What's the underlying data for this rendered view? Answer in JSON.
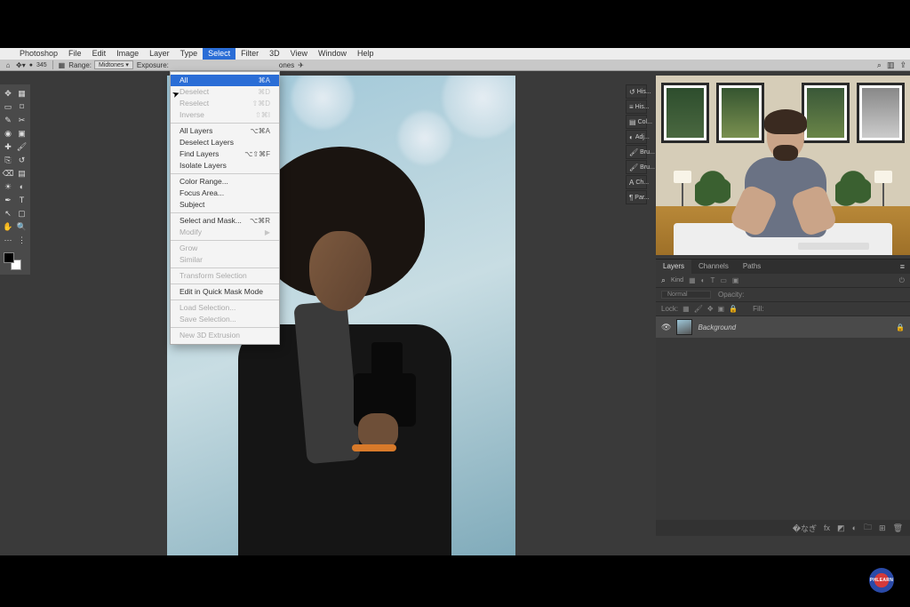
{
  "app_name": "Photoshop",
  "menubar": [
    "Photoshop",
    "File",
    "Edit",
    "Image",
    "Layer",
    "Type",
    "Select",
    "Filter",
    "3D",
    "View",
    "Window",
    "Help"
  ],
  "menubar_selected": "Select",
  "optionsbar": {
    "brush_size": "345",
    "range_label": "Range:",
    "range_value": "Midtones",
    "exposure_label": "Exposure:",
    "extra_label": "ones"
  },
  "dropdown": {
    "groups": [
      [
        {
          "label": "All",
          "shortcut": "⌘A",
          "enabled": true,
          "selected": true
        },
        {
          "label": "Deselect",
          "shortcut": "⌘D",
          "enabled": false
        },
        {
          "label": "Reselect",
          "shortcut": "⇧⌘D",
          "enabled": false
        },
        {
          "label": "Inverse",
          "shortcut": "⇧⌘I",
          "enabled": false
        }
      ],
      [
        {
          "label": "All Layers",
          "shortcut": "⌥⌘A",
          "enabled": true
        },
        {
          "label": "Deselect Layers",
          "shortcut": "",
          "enabled": true
        },
        {
          "label": "Find Layers",
          "shortcut": "⌥⇧⌘F",
          "enabled": true
        },
        {
          "label": "Isolate Layers",
          "shortcut": "",
          "enabled": true
        }
      ],
      [
        {
          "label": "Color Range...",
          "shortcut": "",
          "enabled": true
        },
        {
          "label": "Focus Area...",
          "shortcut": "",
          "enabled": true
        },
        {
          "label": "Subject",
          "shortcut": "",
          "enabled": true
        }
      ],
      [
        {
          "label": "Select and Mask...",
          "shortcut": "⌥⌘R",
          "enabled": true
        },
        {
          "label": "Modify",
          "shortcut": "",
          "enabled": false,
          "submenu": true
        }
      ],
      [
        {
          "label": "Grow",
          "shortcut": "",
          "enabled": false
        },
        {
          "label": "Similar",
          "shortcut": "",
          "enabled": false
        }
      ],
      [
        {
          "label": "Transform Selection",
          "shortcut": "",
          "enabled": false
        }
      ],
      [
        {
          "label": "Edit in Quick Mask Mode",
          "shortcut": "",
          "enabled": true
        }
      ],
      [
        {
          "label": "Load Selection...",
          "shortcut": "",
          "enabled": false
        },
        {
          "label": "Save Selection...",
          "shortcut": "",
          "enabled": false
        }
      ],
      [
        {
          "label": "New 3D Extrusion",
          "shortcut": "",
          "enabled": false
        }
      ]
    ]
  },
  "right_collapsed_panels": [
    "His...",
    "His...",
    "Col...",
    "Adj...",
    "Bru...",
    "Bru...",
    "Ch...",
    "Par..."
  ],
  "layers_panel": {
    "tabs": [
      "Layers",
      "Channels",
      "Paths"
    ],
    "active_tab": "Layers",
    "filter_kind": "Kind",
    "blend_mode_label": "Normal",
    "opacity_label": "Opacity:",
    "lock_label": "Lock:",
    "fill_label": "Fill:",
    "layer_name": "Background"
  },
  "toolbar_tools": [
    "move-tool",
    "artboard-tool",
    "marquee-tool",
    "lasso-tool",
    "quick-select-tool",
    "crop-tool",
    "eyedropper-tool",
    "frame-tool",
    "healing-tool",
    "brush-tool",
    "clone-tool",
    "history-brush-tool",
    "eraser-tool",
    "gradient-tool",
    "dodge-tool",
    "blur-tool",
    "pen-tool",
    "type-tool",
    "path-select-tool",
    "rectangle-tool",
    "hand-tool",
    "zoom-tool",
    "edit-toolbar",
    "more-tool"
  ],
  "toolbar_glyphs": [
    "✥",
    "▦",
    "▭",
    "⌑",
    "✎",
    "✂",
    "◉",
    "▣",
    "✚",
    "🖌",
    "⎘",
    "↺",
    "⌫",
    "▤",
    "☀",
    "◐",
    "✒",
    "T",
    "↖",
    "▢",
    "✋",
    "🔍",
    "⋯",
    "⋮"
  ],
  "badge_text": "PHLEARN"
}
